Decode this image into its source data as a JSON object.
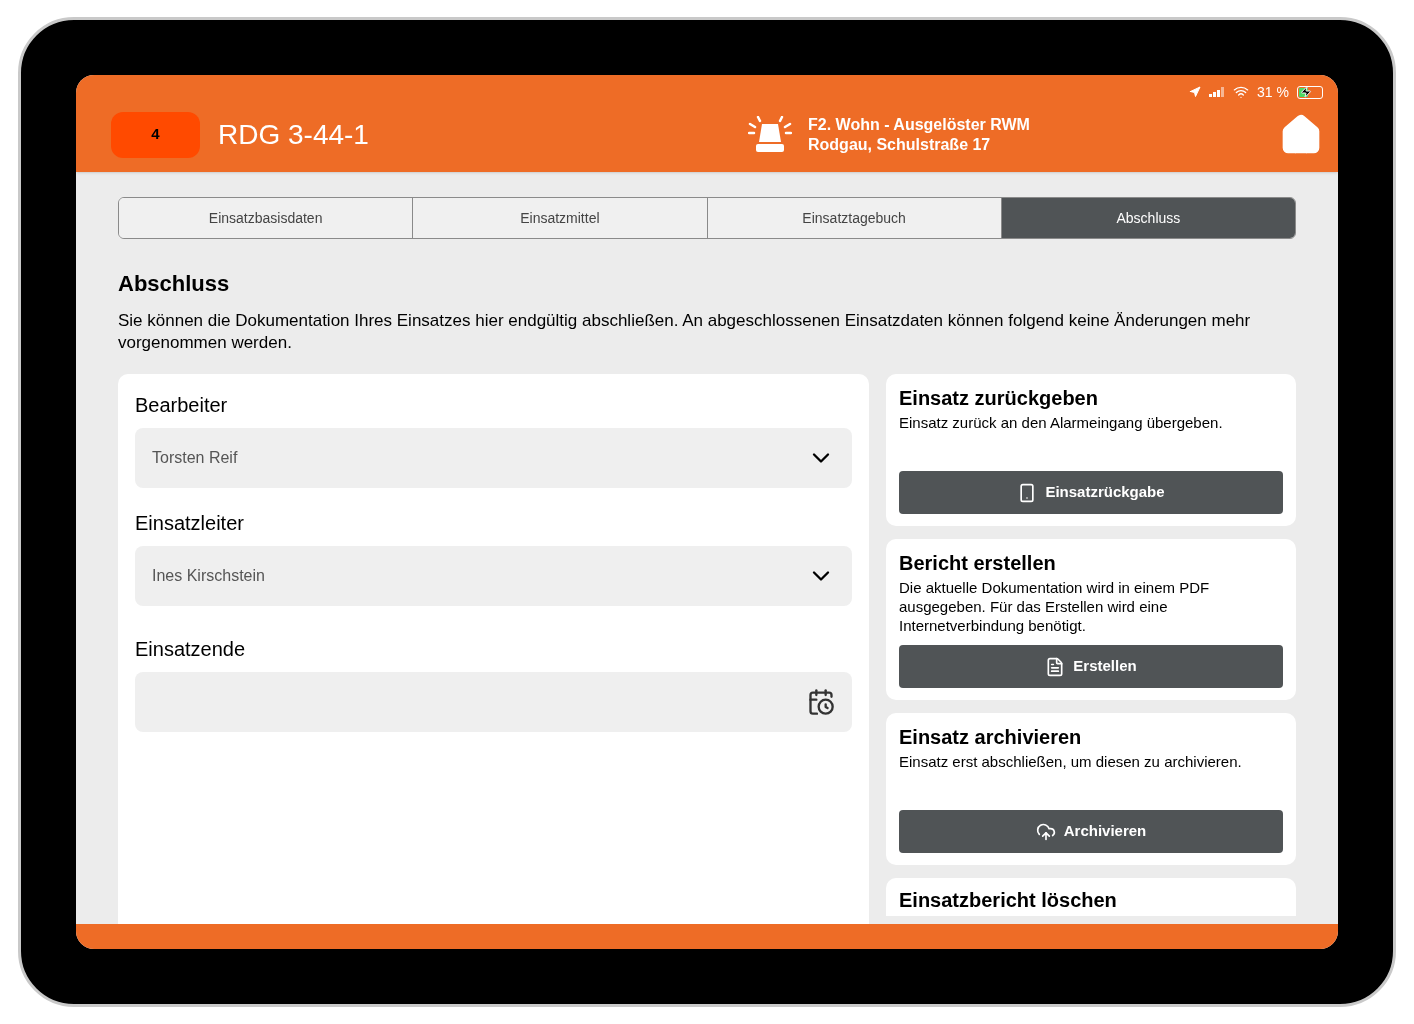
{
  "status_bar": {
    "battery": "31 %"
  },
  "header": {
    "badge": "4",
    "title": "RDG 3-44-1",
    "incident_type": "F2. Wohn - Ausgelöster RWM",
    "address": "Rodgau, Schulstraße 17"
  },
  "tabs": [
    {
      "label": "Einsatzbasisdaten",
      "selected": false
    },
    {
      "label": "Einsatzmittel",
      "selected": false
    },
    {
      "label": "Einsatztagebuch",
      "selected": false
    },
    {
      "label": "Abschluss",
      "selected": true
    }
  ],
  "section": {
    "title": "Abschluss",
    "description": "Sie können die Dokumentation Ihres Einsatzes hier endgültig abschließen. An abgeschlossenen Einsatzdaten können folgend keine Änderungen mehr vorgenommen werden."
  },
  "form": [
    {
      "label": "Bearbeiter",
      "kind": "select",
      "value": "Torsten Reif"
    },
    {
      "label": "Einsatzleiter",
      "kind": "select",
      "value": "Ines Kirschstein"
    },
    {
      "label": "Einsatzende",
      "kind": "date"
    }
  ],
  "actions": [
    {
      "title": "Einsatz zurückgeben",
      "text": "Einsatz zurück an den Alarmeingang übergeben.",
      "button": "Einsatzrückgabe",
      "kind": "handover"
    },
    {
      "title": "Bericht erstellen",
      "text": "Die aktuelle Dokumentation wird in einem PDF ausgegeben. Für das Erstellen wird eine Internetverbindung benötigt.",
      "button": "Erstellen",
      "kind": "pdf"
    },
    {
      "title": "Einsatz archivieren",
      "text": "Einsatz erst abschließen, um diesen zu archivieren.",
      "button": "Archivieren",
      "kind": "archive"
    },
    {
      "title": "Einsatzbericht löschen",
      "kind": "partial"
    }
  ]
}
